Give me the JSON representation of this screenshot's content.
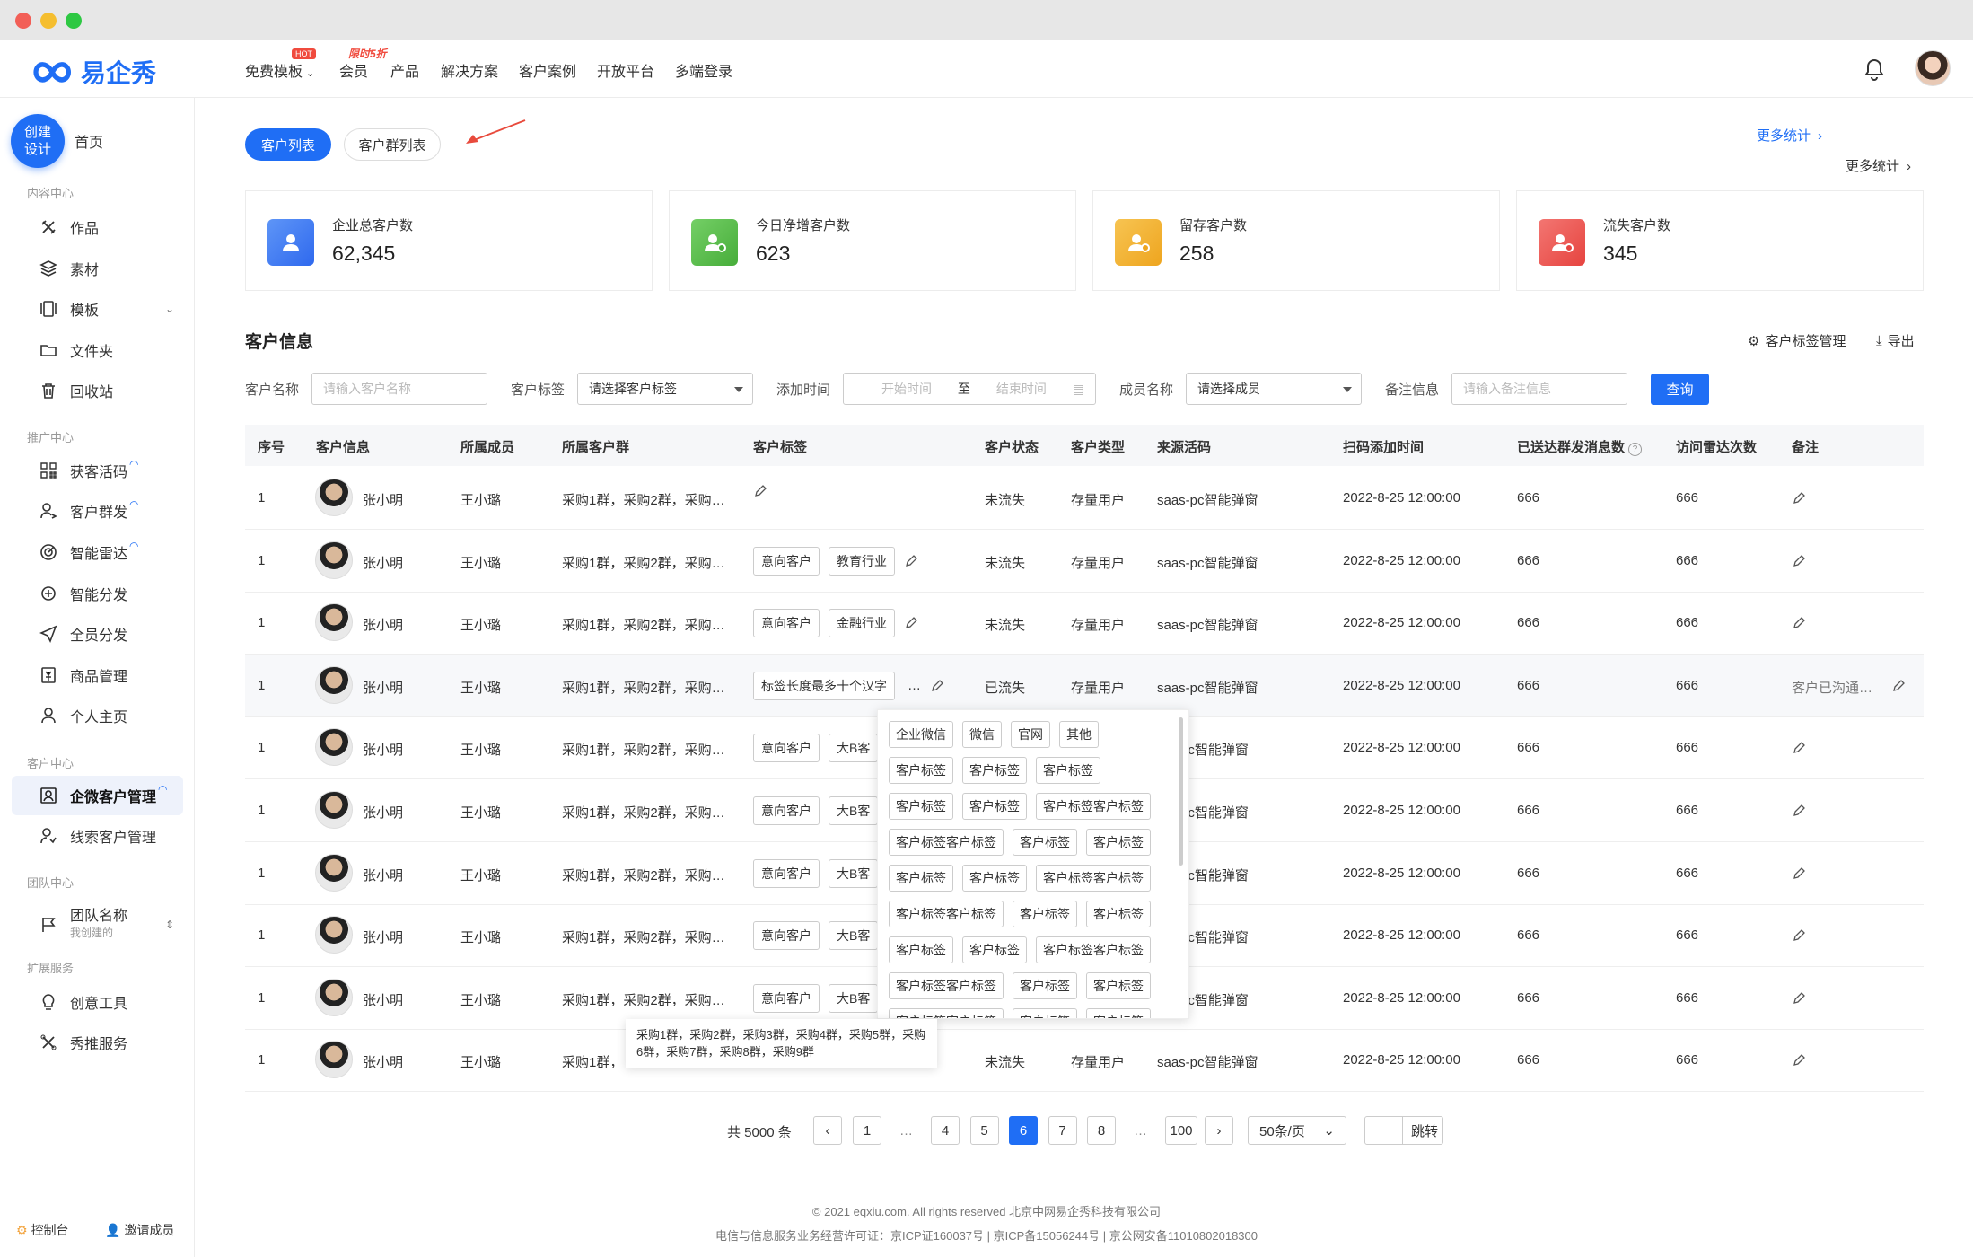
{
  "nav": {
    "brand": "易企秀",
    "items": [
      {
        "label": "免费模板",
        "badge": "HOT",
        "has_caret": true
      },
      {
        "label": "会员",
        "badge": "限时5折"
      },
      {
        "label": "产品"
      },
      {
        "label": "解决方案"
      },
      {
        "label": "客户案例"
      },
      {
        "label": "开放平台"
      },
      {
        "label": "多端登录"
      }
    ]
  },
  "sidebar": {
    "create_label": "创建设计",
    "home": "首页",
    "groups": [
      {
        "title": "内容中心",
        "items": [
          "作品",
          "素材",
          "模板",
          "文件夹",
          "回收站"
        ]
      },
      {
        "title": "推广中心",
        "items": [
          "获客活码",
          "客户群发",
          "智能雷达",
          "智能分发",
          "全员分发",
          "商品管理",
          "个人主页"
        ]
      },
      {
        "title": "客户中心",
        "items": [
          "企微客户管理",
          "线索客户管理"
        ]
      },
      {
        "title": "团队中心",
        "items": [
          "团队名称"
        ]
      },
      {
        "title": "扩展服务",
        "items": [
          "创意工具",
          "秀推服务"
        ]
      }
    ],
    "team_sub": "我创建的",
    "bottom": {
      "console": "控制台",
      "invite": "邀请成员"
    }
  },
  "tabs": {
    "customer_list": "客户列表",
    "group_list": "客户群列表"
  },
  "more_stats": [
    "更多统计",
    "更多统计"
  ],
  "stats": [
    {
      "label": "企业总客户数",
      "value": "62,345",
      "color": "#3d7bf5"
    },
    {
      "label": "今日净增客户数",
      "value": "623",
      "color": "#5bbf4e"
    },
    {
      "label": "留存客户数",
      "value": "258",
      "color": "#f2b233"
    },
    {
      "label": "流失客户数",
      "value": "345",
      "color": "#ef5350"
    }
  ],
  "section": {
    "title": "客户信息",
    "tag_manage": "客户标签管理",
    "export": "导出"
  },
  "filters": {
    "name_label": "客户名称",
    "name_placeholder": "请输入客户名称",
    "tag_label": "客户标签",
    "tag_select": "请选择客户标签",
    "time_label": "添加时间",
    "start": "开始时间",
    "to": "至",
    "end": "结束时间",
    "member_label": "成员名称",
    "member_select": "请选择成员",
    "note_label": "备注信息",
    "note_placeholder": "请输入备注信息",
    "query": "查询"
  },
  "table": {
    "columns": [
      "序号",
      "客户信息",
      "所属成员",
      "所属客户群",
      "客户标签",
      "客户状态",
      "客户类型",
      "来源活码",
      "扫码添加时间",
      "已送达群发消息数",
      "访问雷达次数",
      "备注"
    ],
    "rows": [
      {
        "idx": "1",
        "name": "张小明",
        "member": "王小璐",
        "groups": "采购1群，采购2群，采购…",
        "tags": [],
        "status": "未流失",
        "type": "存量用户",
        "source": "saas-pc智能弹窗",
        "time": "2022-8-25 12:00:00",
        "sent": "666",
        "visits": "666",
        "note": ""
      },
      {
        "idx": "1",
        "name": "张小明",
        "member": "王小璐",
        "groups": "采购1群，采购2群，采购…",
        "tags": [
          "意向客户",
          "教育行业"
        ],
        "status": "未流失",
        "type": "存量用户",
        "source": "saas-pc智能弹窗",
        "time": "2022-8-25 12:00:00",
        "sent": "666",
        "visits": "666",
        "note": ""
      },
      {
        "idx": "1",
        "name": "张小明",
        "member": "王小璐",
        "groups": "采购1群，采购2群，采购…",
        "tags": [
          "意向客户",
          "金融行业"
        ],
        "status": "未流失",
        "type": "存量用户",
        "source": "saas-pc智能弹窗",
        "time": "2022-8-25 12:00:00",
        "sent": "666",
        "visits": "666",
        "note": ""
      },
      {
        "idx": "1",
        "name": "张小明",
        "member": "王小璐",
        "groups": "采购1群，采购2群，采购…",
        "tags": [
          "标签长度最多十个汉字",
          "…"
        ],
        "status": "已流失",
        "type": "存量用户",
        "source": "saas-pc智能弹窗",
        "time": "2022-8-25 12:00:00",
        "sent": "666",
        "visits": "666",
        "note": "客户已沟通…"
      },
      {
        "idx": "1",
        "name": "张小明",
        "member": "王小璐",
        "groups": "采购1群，采购2群，采购…",
        "tags": [
          "意向客户",
          "大B客"
        ],
        "status": "",
        "type": "",
        "source": "-pc智能弹窗",
        "time": "2022-8-25 12:00:00",
        "sent": "666",
        "visits": "666",
        "note": ""
      },
      {
        "idx": "1",
        "name": "张小明",
        "member": "王小璐",
        "groups": "采购1群，采购2群，采购…",
        "tags": [
          "意向客户",
          "大B客"
        ],
        "status": "",
        "type": "",
        "source": "-pc智能弹窗",
        "time": "2022-8-25 12:00:00",
        "sent": "666",
        "visits": "666",
        "note": ""
      },
      {
        "idx": "1",
        "name": "张小明",
        "member": "王小璐",
        "groups": "采购1群，采购2群，采购…",
        "tags": [
          "意向客户",
          "大B客"
        ],
        "status": "",
        "type": "",
        "source": "-pc智能弹窗",
        "time": "2022-8-25 12:00:00",
        "sent": "666",
        "visits": "666",
        "note": ""
      },
      {
        "idx": "1",
        "name": "张小明",
        "member": "王小璐",
        "groups": "采购1群，采购2群，采购…",
        "tags": [
          "意向客户",
          "大B客"
        ],
        "status": "",
        "type": "",
        "source": "-pc智能弹窗",
        "time": "2022-8-25 12:00:00",
        "sent": "666",
        "visits": "666",
        "note": ""
      },
      {
        "idx": "1",
        "name": "张小明",
        "member": "王小璐",
        "groups": "采购1群，采购2群，采购…",
        "tags": [
          "意向客户",
          "大B客"
        ],
        "status": "",
        "type": "",
        "source": "-pc智能弹窗",
        "time": "2022-8-25 12:00:00",
        "sent": "666",
        "visits": "666",
        "note": ""
      },
      {
        "idx": "1",
        "name": "张小明",
        "member": "王小璐",
        "groups": "采购1群，",
        "tags": [],
        "status": "未流失",
        "type": "存量用户",
        "source": "saas-pc智能弹窗",
        "time": "2022-8-25 12:00:00",
        "sent": "666",
        "visits": "666",
        "note": ""
      }
    ]
  },
  "tag_popup": [
    "企业微信",
    "微信",
    "官网",
    "其他",
    "客户标签",
    "客户标签",
    "客户标签",
    "客户标签",
    "客户标签",
    "客户标签客户标签",
    "客户标签客户标签",
    "客户标签",
    "客户标签",
    "客户标签",
    "客户标签",
    "客户标签客户标签",
    "客户标签客户标签",
    "客户标签",
    "客户标签",
    "客户标签",
    "客户标签",
    "客户标签客户标签",
    "客户标签客户标签",
    "客户标签",
    "客户标签",
    "客户标签客户标签",
    "客户标签",
    "客户标签"
  ],
  "group_tooltip": "采购1群，采购2群，采购3群，采购4群，采购5群，采购6群，采购7群，采购8群，采购9群",
  "pagination": {
    "total": "共 5000 条",
    "pages": [
      "1",
      "…",
      "4",
      "5",
      "6",
      "7",
      "8",
      "…",
      "100"
    ],
    "current": "6",
    "page_size": "50条/页",
    "jump": "跳转"
  },
  "footer": {
    "line1": "© 2021 eqxiu.com. All rights reserved 北京中网易企秀科技有限公司",
    "line2": "电信与信息服务业务经营许可证：京ICP证160037号 | 京ICP备15056244号 | 京公网安备11010802018300"
  }
}
